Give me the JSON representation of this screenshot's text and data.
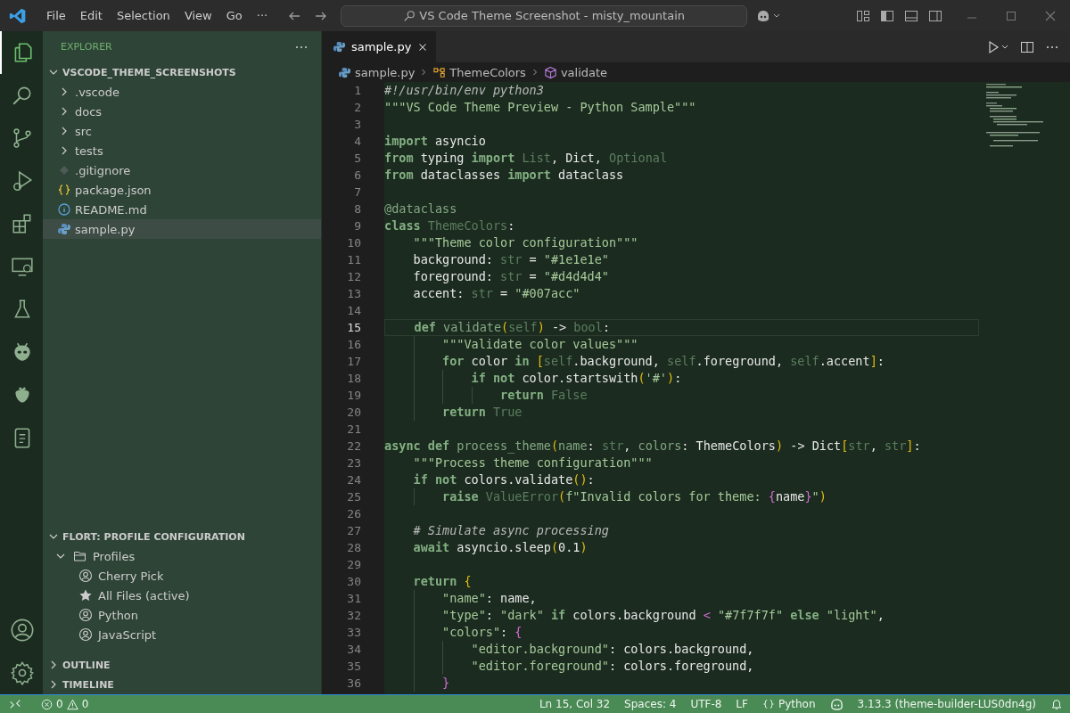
{
  "title_bar": {
    "menu": [
      "File",
      "Edit",
      "Selection",
      "View",
      "Go",
      "···"
    ],
    "search": "VS Code Theme Screenshot - misty_mountain"
  },
  "activity_bar": {
    "top": [
      {
        "kind": "files",
        "selected": true
      },
      {
        "kind": "search",
        "selected": false
      },
      {
        "kind": "source-control",
        "selected": false
      },
      {
        "kind": "run",
        "selected": false
      },
      {
        "kind": "extensions",
        "selected": false
      },
      {
        "kind": "remote",
        "selected": false
      },
      {
        "kind": "flask",
        "selected": false
      },
      {
        "kind": "alien",
        "selected": false
      },
      {
        "kind": "berry",
        "selected": false
      },
      {
        "kind": "notes",
        "selected": false
      }
    ],
    "bottom": [
      {
        "kind": "account"
      },
      {
        "kind": "settings"
      }
    ]
  },
  "sidebar": {
    "title": "EXPLORER",
    "root": {
      "label": "VSCODE_THEME_SCREENSHOTS",
      "expanded": true,
      "children": [
        {
          "label": ".vscode",
          "kind": "folder",
          "expanded": false,
          "selected": false
        },
        {
          "label": "docs",
          "kind": "folder",
          "expanded": false,
          "selected": false
        },
        {
          "label": "src",
          "kind": "folder",
          "expanded": false,
          "selected": false
        },
        {
          "label": "tests",
          "kind": "folder",
          "expanded": false,
          "selected": false
        },
        {
          "label": ".gitignore",
          "kind": "git",
          "selected": false
        },
        {
          "label": "package.json",
          "kind": "json",
          "selected": false
        },
        {
          "label": "README.md",
          "kind": "info",
          "selected": false
        },
        {
          "label": "sample.py",
          "kind": "python",
          "selected": true
        }
      ]
    },
    "profiles_section": {
      "title": "FLORT: PROFILE CONFIGURATION",
      "expanded": true,
      "folder": {
        "label": "Profiles",
        "expanded": true,
        "children": [
          {
            "label": "Cherry Pick",
            "kind": "person"
          },
          {
            "label": "All Files (active)",
            "kind": "star"
          },
          {
            "label": "Python",
            "kind": "person"
          },
          {
            "label": "JavaScript",
            "kind": "person"
          }
        ]
      }
    },
    "collapsed_sections": [
      "OUTLINE",
      "TIMELINE"
    ]
  },
  "editor": {
    "tabs": [
      {
        "label": "sample.py",
        "selected": true
      }
    ],
    "breadcrumbs": [
      {
        "label": "sample.py",
        "kind": "python"
      },
      {
        "label": "ThemeColors",
        "kind": "class"
      },
      {
        "label": "validate",
        "kind": "method"
      }
    ],
    "lines": [
      {
        "number": "1",
        "current": false,
        "tokens": [
          {
            "kind": "comment",
            "text": "#!/usr/bin/env python3"
          }
        ]
      },
      {
        "number": "2",
        "current": false,
        "tokens": [
          {
            "kind": "str",
            "text": "\"\"\"VS Code Theme Preview - Python Sample\"\"\""
          }
        ]
      },
      {
        "number": "3",
        "current": false
      },
      {
        "number": "4",
        "current": false,
        "tokens": [
          {
            "kind": "kw",
            "text": "import"
          },
          {
            "kind": "plain",
            "text": " asyncio"
          }
        ]
      },
      {
        "number": "5",
        "current": false,
        "tokens": [
          {
            "kind": "kw",
            "text": "from"
          },
          {
            "kind": "plain",
            "text": " typing "
          },
          {
            "kind": "kw",
            "text": "import"
          },
          {
            "kind": "dim",
            "text": " List"
          },
          {
            "kind": "plain",
            "text": ", Dict, "
          },
          {
            "kind": "dim",
            "text": "Optional"
          }
        ]
      },
      {
        "number": "6",
        "current": false,
        "tokens": [
          {
            "kind": "kw",
            "text": "from"
          },
          {
            "kind": "plain",
            "text": " dataclasses "
          },
          {
            "kind": "kw",
            "text": "import"
          },
          {
            "kind": "plain",
            "text": " dataclass"
          }
        ]
      },
      {
        "number": "7",
        "current": false
      },
      {
        "number": "8",
        "current": false,
        "tokens": [
          {
            "kind": "fn",
            "text": "@dataclass"
          }
        ]
      },
      {
        "number": "9",
        "current": false,
        "tokens": [
          {
            "kind": "kw",
            "text": "class"
          },
          {
            "kind": "dim",
            "text": " ThemeColors"
          },
          {
            "kind": "plain",
            "text": ":"
          }
        ],
        "children": [
          {
            "number": "10",
            "current": false,
            "tokens": [
              {
                "kind": "str",
                "text": "\"\"\"Theme color configuration\"\"\""
              }
            ]
          },
          {
            "number": "11",
            "current": false,
            "tokens": [
              {
                "kind": "plain",
                "text": "background: "
              },
              {
                "kind": "dim",
                "text": "str"
              },
              {
                "kind": "plain",
                "text": " = "
              },
              {
                "kind": "str",
                "text": "\"#1e1e1e\""
              }
            ]
          },
          {
            "number": "12",
            "current": false,
            "tokens": [
              {
                "kind": "plain",
                "text": "foreground: "
              },
              {
                "kind": "dim",
                "text": "str"
              },
              {
                "kind": "plain",
                "text": " = "
              },
              {
                "kind": "str",
                "text": "\"#d4d4d4\""
              }
            ]
          },
          {
            "number": "13",
            "current": false,
            "tokens": [
              {
                "kind": "plain",
                "text": "accent: "
              },
              {
                "kind": "dim",
                "text": "str"
              },
              {
                "kind": "plain",
                "text": " = "
              },
              {
                "kind": "str",
                "text": "\"#007acc\""
              }
            ]
          },
          {
            "number": "14",
            "current": false
          },
          {
            "number": "15",
            "current": true,
            "tokens": [
              {
                "kind": "kw",
                "text": "def"
              },
              {
                "kind": "fn",
                "text": " validate"
              },
              {
                "kind": "brk",
                "text": "("
              },
              {
                "kind": "dim",
                "text": "self"
              },
              {
                "kind": "brk",
                "text": ")"
              },
              {
                "kind": "plain",
                "text": " -> "
              },
              {
                "kind": "dim",
                "text": "bool"
              },
              {
                "kind": "plain",
                "text": ":"
              }
            ],
            "children": [
              {
                "number": "16",
                "current": false,
                "tokens": [
                  {
                    "kind": "str",
                    "text": "\"\"\"Validate color values\"\"\""
                  }
                ]
              },
              {
                "number": "17",
                "current": false,
                "tokens": [
                  {
                    "kind": "kw",
                    "text": "for"
                  },
                  {
                    "kind": "plain",
                    "text": " color "
                  },
                  {
                    "kind": "kw",
                    "text": "in"
                  },
                  {
                    "kind": "brk",
                    "text": " ["
                  },
                  {
                    "kind": "dim",
                    "text": "self"
                  },
                  {
                    "kind": "plain",
                    "text": ".background, "
                  },
                  {
                    "kind": "dim",
                    "text": "self"
                  },
                  {
                    "kind": "plain",
                    "text": ".foreground, "
                  },
                  {
                    "kind": "dim",
                    "text": "self"
                  },
                  {
                    "kind": "plain",
                    "text": ".accent"
                  },
                  {
                    "kind": "brk",
                    "text": "]"
                  },
                  {
                    "kind": "plain",
                    "text": ":"
                  }
                ],
                "children": [
                  {
                    "number": "18",
                    "current": false,
                    "tokens": [
                      {
                        "kind": "kw",
                        "text": "if"
                      },
                      {
                        "kind": "kw",
                        "text": " not"
                      },
                      {
                        "kind": "plain",
                        "text": " color.startswith"
                      },
                      {
                        "kind": "brk",
                        "text": "("
                      },
                      {
                        "kind": "str",
                        "text": "'#'"
                      },
                      {
                        "kind": "brk",
                        "text": ")"
                      },
                      {
                        "kind": "plain",
                        "text": ":"
                      }
                    ],
                    "children": [
                      {
                        "number": "19",
                        "current": false,
                        "tokens": [
                          {
                            "kind": "kw",
                            "text": "return"
                          },
                          {
                            "kind": "dim",
                            "text": " False"
                          }
                        ]
                      }
                    ]
                  }
                ]
              },
              {
                "number": "20",
                "current": false,
                "tokens": [
                  {
                    "kind": "kw",
                    "text": "return"
                  },
                  {
                    "kind": "dim",
                    "text": " True"
                  }
                ]
              }
            ]
          }
        ]
      },
      {
        "number": "21",
        "current": false
      },
      {
        "number": "22",
        "current": false,
        "tokens": [
          {
            "kind": "kw",
            "text": "async"
          },
          {
            "kind": "kw",
            "text": " def"
          },
          {
            "kind": "fn",
            "text": " process_theme"
          },
          {
            "kind": "brk",
            "text": "("
          },
          {
            "kind": "fn",
            "text": "name"
          },
          {
            "kind": "plain",
            "text": ": "
          },
          {
            "kind": "dim",
            "text": "str"
          },
          {
            "kind": "plain",
            "text": ", "
          },
          {
            "kind": "fn",
            "text": "colors"
          },
          {
            "kind": "plain",
            "text": ": ThemeColors"
          },
          {
            "kind": "brk",
            "text": ")"
          },
          {
            "kind": "plain",
            "text": " -> Dict"
          },
          {
            "kind": "brk",
            "text": "["
          },
          {
            "kind": "dim",
            "text": "str"
          },
          {
            "kind": "plain",
            "text": ", "
          },
          {
            "kind": "dim",
            "text": "str"
          },
          {
            "kind": "brk",
            "text": "]"
          },
          {
            "kind": "plain",
            "text": ":"
          }
        ],
        "children": [
          {
            "number": "23",
            "current": false,
            "tokens": [
              {
                "kind": "str",
                "text": "\"\"\"Process theme configuration\"\"\""
              }
            ]
          },
          {
            "number": "24",
            "current": false,
            "tokens": [
              {
                "kind": "kw",
                "text": "if"
              },
              {
                "kind": "kw",
                "text": " not"
              },
              {
                "kind": "plain",
                "text": " colors.validate"
              },
              {
                "kind": "brk",
                "text": "()"
              },
              {
                "kind": "plain",
                "text": ":"
              }
            ],
            "children": [
              {
                "number": "25",
                "current": false,
                "tokens": [
                  {
                    "kind": "kw",
                    "text": "raise"
                  },
                  {
                    "kind": "dim",
                    "text": " ValueError"
                  },
                  {
                    "kind": "brk",
                    "text": "("
                  },
                  {
                    "kind": "str",
                    "text": "f\"Invalid colors for theme: "
                  },
                  {
                    "kind": "brk2",
                    "text": "{"
                  },
                  {
                    "kind": "plain",
                    "text": "name"
                  },
                  {
                    "kind": "brk2",
                    "text": "}"
                  },
                  {
                    "kind": "str",
                    "text": "\""
                  },
                  {
                    "kind": "brk",
                    "text": ")"
                  }
                ]
              }
            ]
          },
          {
            "number": "26",
            "current": false
          },
          {
            "number": "27",
            "current": false,
            "tokens": [
              {
                "kind": "comment",
                "text": "# Simulate async processing"
              }
            ]
          },
          {
            "number": "28",
            "current": false,
            "tokens": [
              {
                "kind": "kw",
                "text": "await"
              },
              {
                "kind": "plain",
                "text": " asyncio.sleep"
              },
              {
                "kind": "brk",
                "text": "("
              },
              {
                "kind": "plain",
                "text": "0.1"
              },
              {
                "kind": "brk",
                "text": ")"
              }
            ]
          },
          {
            "number": "29",
            "current": false
          },
          {
            "number": "30",
            "current": false,
            "tokens": [
              {
                "kind": "kw",
                "text": "return"
              },
              {
                "kind": "brk",
                "text": " {"
              }
            ],
            "children": [
              {
                "number": "31",
                "current": false,
                "tokens": [
                  {
                    "kind": "str",
                    "text": "\"name\""
                  },
                  {
                    "kind": "plain",
                    "text": ": name,"
                  }
                ]
              },
              {
                "number": "32",
                "current": false,
                "tokens": [
                  {
                    "kind": "str",
                    "text": "\"type\""
                  },
                  {
                    "kind": "plain",
                    "text": ": "
                  },
                  {
                    "kind": "str",
                    "text": "\"dark\""
                  },
                  {
                    "kind": "kw",
                    "text": " if"
                  },
                  {
                    "kind": "plain",
                    "text": " colors.background "
                  },
                  {
                    "kind": "brk2",
                    "text": "<"
                  },
                  {
                    "kind": "str",
                    "text": " \"#7f7f7f\""
                  },
                  {
                    "kind": "kw",
                    "text": " else"
                  },
                  {
                    "kind": "str",
                    "text": " \"light\""
                  },
                  {
                    "kind": "plain",
                    "text": ","
                  }
                ]
              },
              {
                "number": "33",
                "current": false,
                "tokens": [
                  {
                    "kind": "str",
                    "text": "\"colors\""
                  },
                  {
                    "kind": "plain",
                    "text": ": "
                  },
                  {
                    "kind": "brk2",
                    "text": "{"
                  }
                ],
                "children": [
                  {
                    "number": "34",
                    "current": false,
                    "tokens": [
                      {
                        "kind": "str",
                        "text": "\"editor.background\""
                      },
                      {
                        "kind": "plain",
                        "text": ": colors.background,"
                      }
                    ]
                  },
                  {
                    "number": "35",
                    "current": false,
                    "tokens": [
                      {
                        "kind": "str",
                        "text": "\"editor.foreground\""
                      },
                      {
                        "kind": "plain",
                        "text": ": colors.foreground,"
                      }
                    ]
                  }
                ]
              },
              {
                "number": "36",
                "current": false,
                "tokens": [
                  {
                    "kind": "brk2",
                    "text": "}"
                  }
                ]
              }
            ]
          }
        ]
      }
    ]
  },
  "status_bar": {
    "errors": "0",
    "warnings": "0",
    "cursor": "Ln 15, Col 32",
    "spaces": "Spaces: 4",
    "encoding": "UTF-8",
    "eol": "LF",
    "language": "Python",
    "interpreter": "3.13.3 (theme-builder-LUS0dn4g)"
  }
}
